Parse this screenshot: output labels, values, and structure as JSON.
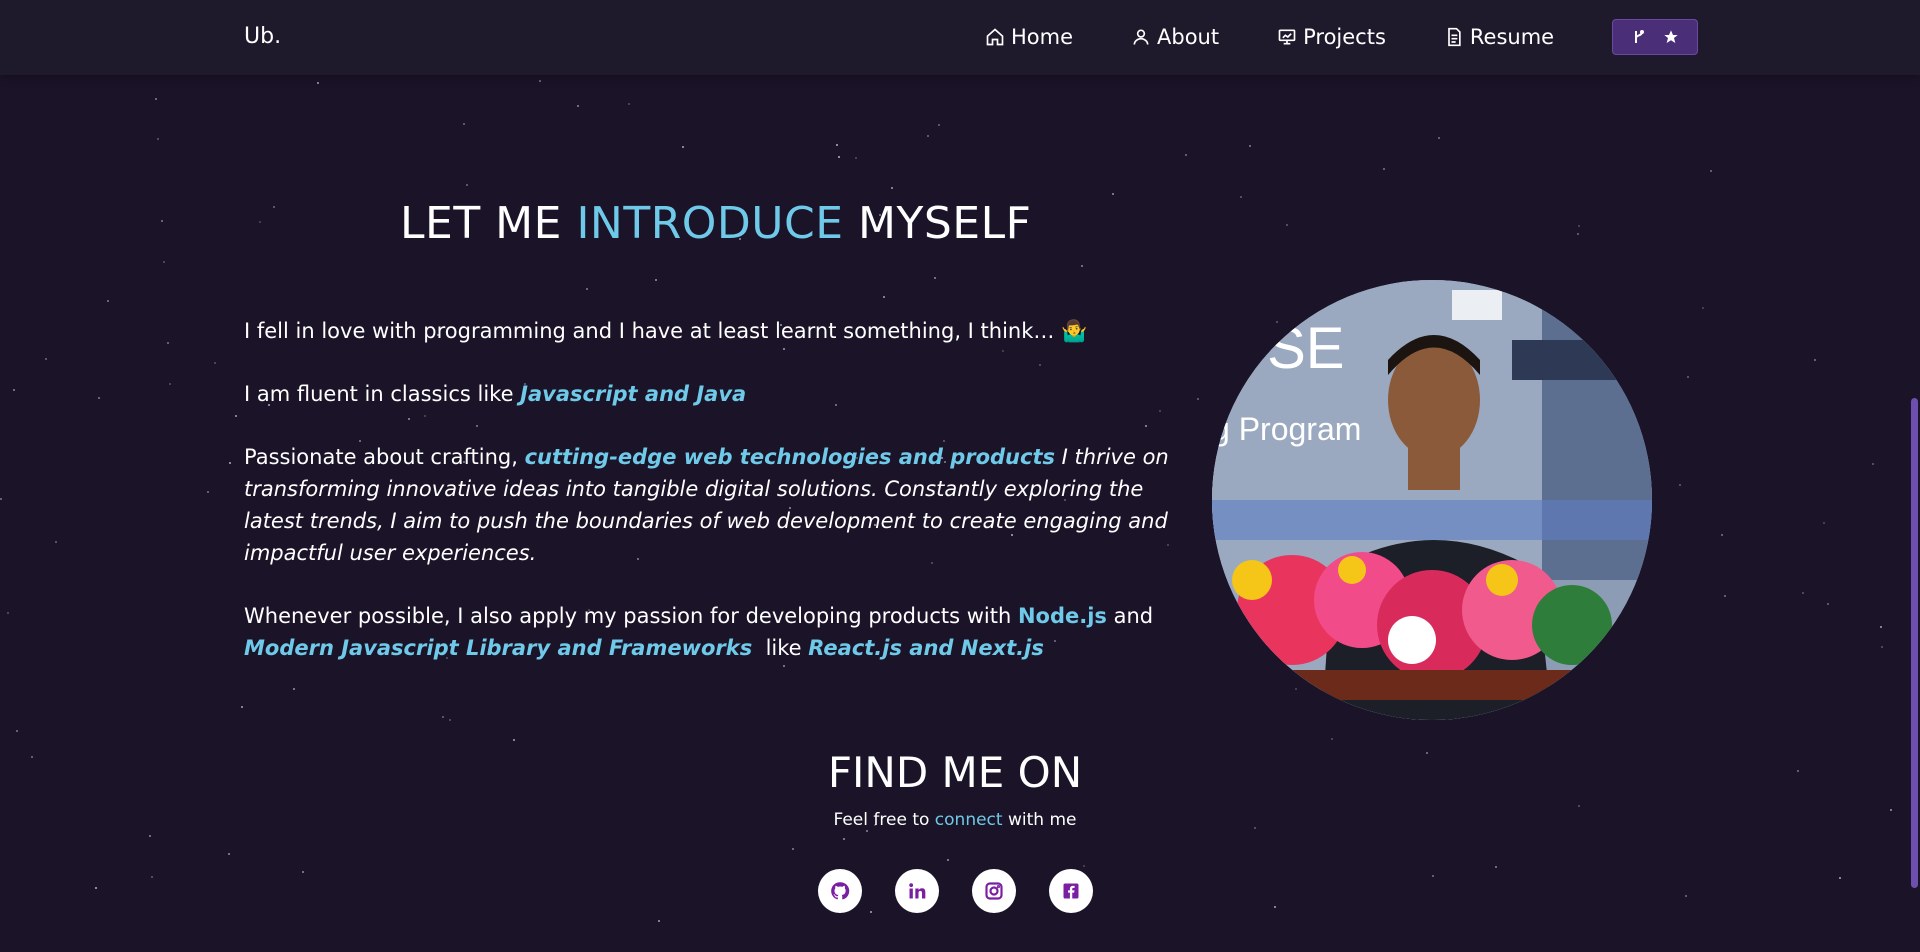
{
  "nav": {
    "logo": "Ub.",
    "items": [
      {
        "label": "Home",
        "icon": "home-icon"
      },
      {
        "label": "About",
        "icon": "user-icon"
      },
      {
        "label": "Projects",
        "icon": "projects-icon"
      },
      {
        "label": "Resume",
        "icon": "document-icon"
      }
    ],
    "fork_icon": "git-fork-icon",
    "star_icon": "star-icon"
  },
  "intro": {
    "title_pre": "LET ME ",
    "title_accent": "INTRODUCE",
    "title_post": " MYSELF",
    "p1": "I fell in love with programming and I have at least learnt something, I think… 🤷‍♂️",
    "p2_pre": "I am fluent in classics like ",
    "p2_hl": "Javascript and Java",
    "p3_pre": "Passionate about crafting, ",
    "p3_hl": "cutting-edge web technologies and products",
    "p3_post": " I thrive on transforming innovative ideas into tangible digital solutions. Constantly exploring the latest trends, I aim to push the boundaries of web development to create engaging and impactful user experiences.",
    "p4_pre": "Whenever possible, I also apply my passion for developing products with ",
    "p4_hl1": "Node.js",
    "p4_mid": " and ",
    "p4_hl2": "Modern Javascript Library and Frameworks",
    "p4_mid2": "  like ",
    "p4_hl3": "React.js and Next.js"
  },
  "find": {
    "title": "FIND ME ON",
    "sub_pre": "Feel free to ",
    "sub_accent": "connect",
    "sub_post": " with me",
    "socials": [
      "github-icon",
      "linkedin-icon",
      "instagram-icon",
      "facebook-icon"
    ]
  },
  "colors": {
    "background": "#1b1429",
    "navbar": "#1e1a2c",
    "accent": "#6fc9e8",
    "button": "#4a2f78",
    "social_icon": "#7a1fa2"
  }
}
